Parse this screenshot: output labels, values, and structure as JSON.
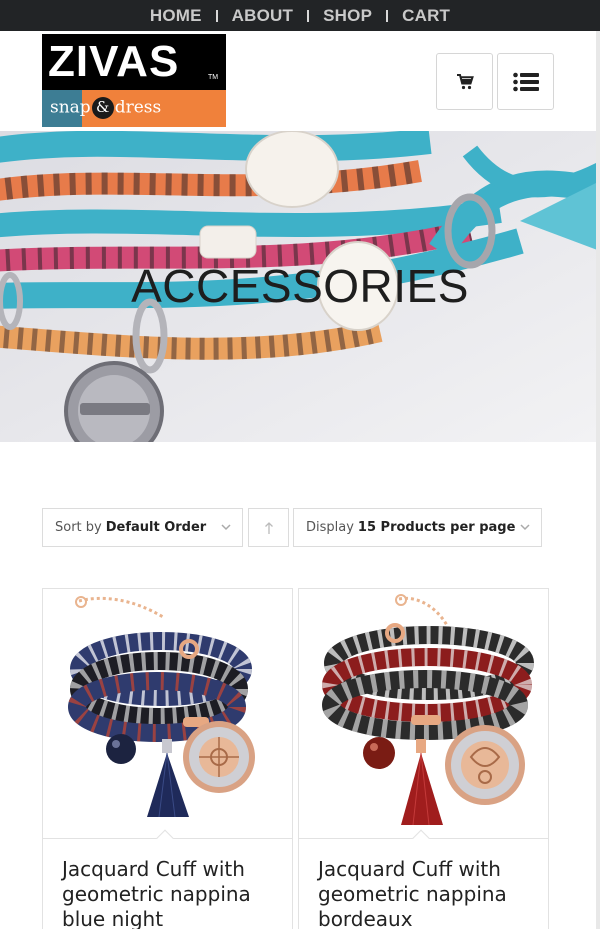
{
  "nav": {
    "items": [
      {
        "label": "HOME"
      },
      {
        "label": "ABOUT"
      },
      {
        "label": "SHOP"
      },
      {
        "label": "CART"
      }
    ]
  },
  "logo": {
    "word": "ZIVAS",
    "tm": "TM",
    "tagline_left": "snap",
    "tagline_amp": "&",
    "tagline_right": "dress"
  },
  "header": {
    "cart_icon": "cart-icon",
    "menu_icon": "list-menu-icon"
  },
  "hero": {
    "title": "ACCESSORIES"
  },
  "sorting": {
    "sort_label": "Sort by",
    "sort_value": "Default Order",
    "display_label": "Display",
    "display_value": "15 Products per page"
  },
  "products": [
    {
      "name": "Jacquard Cuff with geometric nappina blue night",
      "accent": "#1f2a5a"
    },
    {
      "name": "Jacquard Cuff with geometric nappina bordeaux",
      "accent": "#a01d1d"
    }
  ],
  "colors": {
    "nav_bg": "#222426",
    "logo_orange": "#f0813b",
    "teal": "#3eb1c8"
  }
}
